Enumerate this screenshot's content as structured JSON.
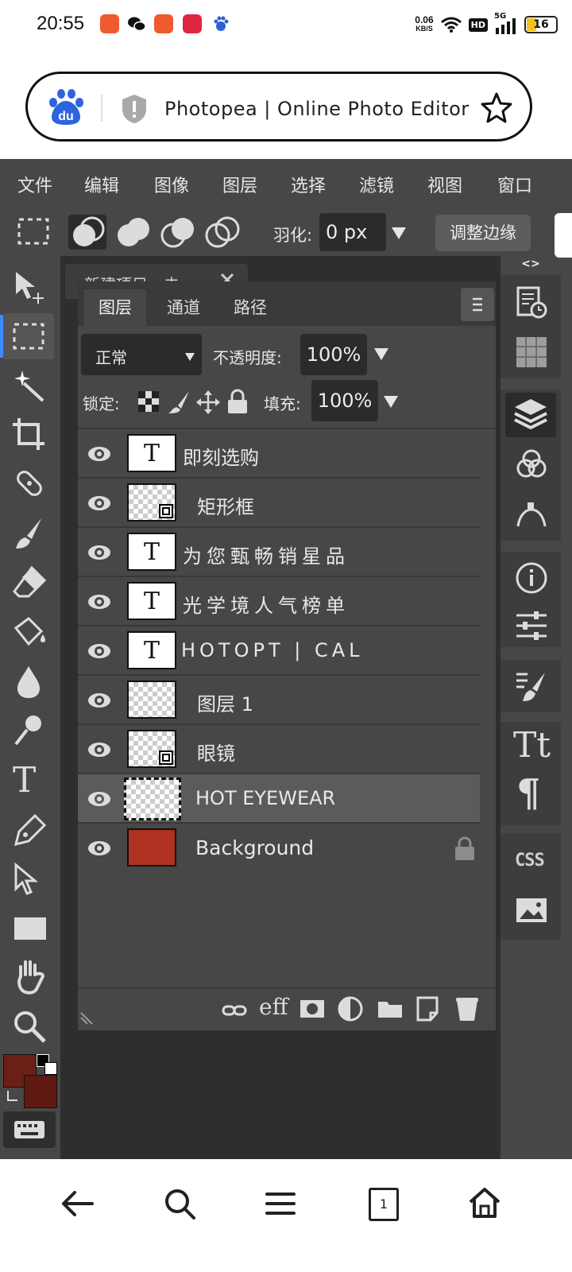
{
  "status_bar": {
    "time": "20:55",
    "net_speed_value": "0.06",
    "net_speed_unit": "KB/S",
    "hd_badge": "HD",
    "signal": "5G",
    "battery": "16"
  },
  "browser": {
    "page_title": "Photopea | Online Photo Editor",
    "logo_text": "du"
  },
  "menu": {
    "items": [
      "文件",
      "编辑",
      "图像",
      "图层",
      "选择",
      "滤镜",
      "视图",
      "窗口"
    ]
  },
  "options": {
    "feather_label": "羽化:",
    "feather_value": "0 px",
    "refine_edge": "调整边缘"
  },
  "document_tab": {
    "title": "新建项目 - 未"
  },
  "right_panel_toggle": "<>",
  "layers_panel": {
    "tabs": [
      "图层",
      "通道",
      "路径"
    ],
    "blend_mode": "正常",
    "opacity_label": "不透明度:",
    "opacity_value": "100%",
    "lock_label": "锁定:",
    "fill_label": "填充:",
    "fill_value": "100%",
    "layers": [
      {
        "name": "即刻选购",
        "thumb": "text"
      },
      {
        "name": "矩形框",
        "thumb": "smart"
      },
      {
        "name": "为您甄畅销星品",
        "thumb": "text"
      },
      {
        "name": "光学境人气榜单",
        "thumb": "text"
      },
      {
        "name": "HOTOPT | CAL",
        "thumb": "text"
      },
      {
        "name": "图层 1",
        "thumb": "checker"
      },
      {
        "name": "眼镜",
        "thumb": "smart"
      },
      {
        "name": "HOT EYEWEAR",
        "thumb": "checker",
        "selected": true
      },
      {
        "name": "Background",
        "thumb": "color",
        "locked": true
      }
    ],
    "footer_icons": [
      "link-icon",
      "effects-icon",
      "mask-icon",
      "adjustment-icon",
      "folder-icon",
      "new-layer-icon",
      "trash-icon"
    ],
    "effects_label": "eff"
  },
  "right_toolbar": {
    "css_label": "CSS"
  },
  "colors": {
    "foreground": "#6b1f16",
    "background": "#5e1a13",
    "accent": "#3d8bff"
  }
}
